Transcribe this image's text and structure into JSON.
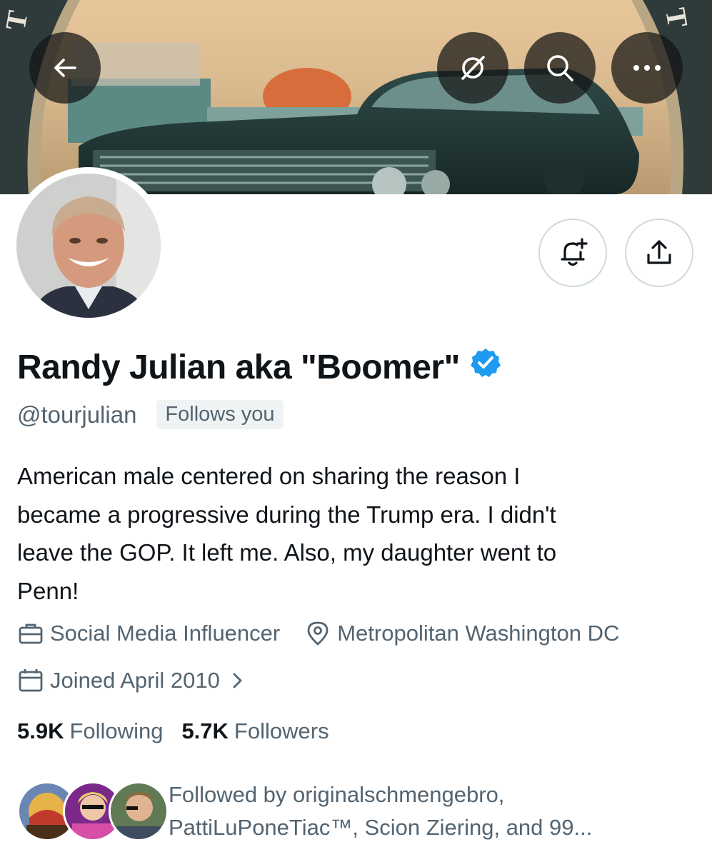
{
  "header": {
    "back_icon": "arrow-left-icon",
    "grok_icon": "grok-icon",
    "search_icon": "search-icon",
    "more_icon": "more-dots-icon"
  },
  "profile": {
    "display_name": "Randy Julian aka \"Boomer\"",
    "verified": true,
    "handle": "@tourjulian",
    "follows_you": "Follows you",
    "bio": "American male centered on sharing the reason I became a progressive during the Trump era. I didn't leave the GOP. It left me. Also, my daughter went to Penn!",
    "bio_lines": [
      "American male centered on sharing the reason I",
      "became a progressive during the Trump era. I didn't",
      "leave the GOP. It left me. Also, my daughter went to",
      "Penn!"
    ],
    "profession": "Social Media Influencer",
    "location": "Metropolitan Washington DC",
    "joined": "Joined April 2010",
    "following_count": "5.9K",
    "following_label": "Following",
    "followers_count": "5.7K",
    "followers_label": "Followers"
  },
  "followed_by": {
    "line1": "Followed by originalschmengebro,",
    "line2": "PattiLuPoneTiac™, Scion Ziering, and 99..."
  },
  "actions": {
    "notify_icon": "bell-plus-icon",
    "share_icon": "share-icon"
  },
  "colors": {
    "verified_blue": "#1d9bf0",
    "secondary_text": "#536471",
    "primary_text": "#0f1419"
  }
}
